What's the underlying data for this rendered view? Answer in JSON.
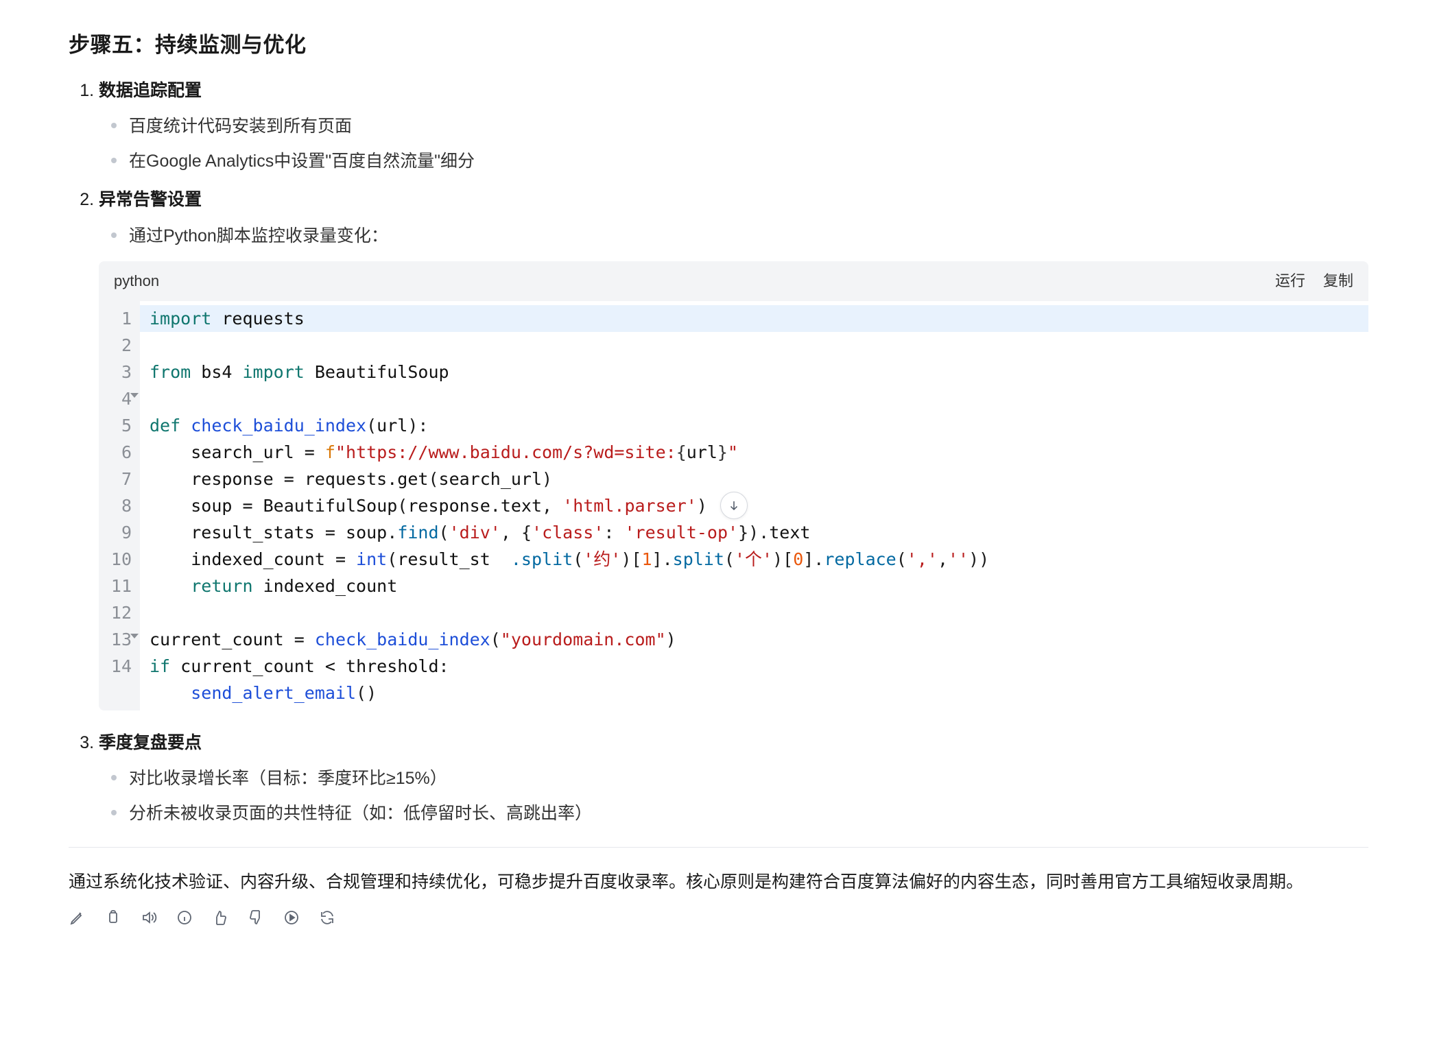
{
  "heading": "步骤五：持续监测与优化",
  "items": {
    "i1": {
      "title": "数据追踪配置",
      "bullets": [
        "百度统计代码安装到所有页面",
        "在Google Analytics中设置\"百度自然流量\"细分"
      ]
    },
    "i2": {
      "title": "异常告警设置",
      "bullets": [
        "通过Python脚本监控收录量变化："
      ]
    },
    "i3": {
      "title": "季度复盘要点",
      "bullets": [
        "对比收录增长率（目标：季度环比≥15%）",
        "分析未被收录页面的共性特征（如：低停留时长、高跳出率）"
      ]
    }
  },
  "code": {
    "lang": "python",
    "actions": {
      "run": "运行",
      "copy": "复制"
    },
    "line_numbers": [
      "1",
      "2",
      "3",
      "4",
      "5",
      "6",
      "7",
      "8",
      "9",
      "10",
      "11",
      "12",
      "13",
      "14"
    ],
    "fold_lines": [
      4,
      13
    ],
    "tokens": {
      "l1": {
        "kw1": "import",
        "mod1": "requests"
      },
      "l2": {
        "kw1": "from",
        "mod1": "bs4",
        "kw2": "import",
        "cls1": "BeautifulSoup"
      },
      "l4": {
        "kw1": "def",
        "fn": "check_baidu_index",
        "p1": "url"
      },
      "l5": {
        "var": "search_url",
        "eq": "=",
        "f": "f",
        "str": "\"https://www.baidu.com/s?wd=site:",
        "interp_open": "{",
        "interp_var": "url",
        "interp_close": "}",
        "str_end": "\""
      },
      "l6": {
        "var": "response",
        "eq": "=",
        "call": "requests.get",
        "arg": "search_url"
      },
      "l7": {
        "var": "soup",
        "eq": "=",
        "call": "BeautifulSoup",
        "arg1": "response.text",
        "arg2": "'html.parser'"
      },
      "l8": {
        "var": "result_stats",
        "eq": "=",
        "obj": "soup",
        "meth": "find",
        "arg1": "'div'",
        "k1": "'class'",
        "v1": "'result-op'",
        "attr": "text"
      },
      "l9": {
        "var": "indexed_count",
        "eq": "=",
        "fn": "int",
        "obj": "result_st",
        "obj2": ".split",
        "s1": "'约'",
        "idx1": "1",
        "m2": "split",
        "s2": "'个'",
        "idx2": "0",
        "m3": "replace",
        "s3a": "','",
        "s3b": "''"
      },
      "l10": {
        "kw": "return",
        "var": "indexed_count"
      },
      "l12": {
        "var": "current_count",
        "eq": "=",
        "fn": "check_baidu_index",
        "arg": "\"yourdomain.com\""
      },
      "l13": {
        "kw": "if",
        "var": "current_count",
        "op": "<",
        "var2": "threshold"
      },
      "l14": {
        "fn": "send_alert_email"
      }
    }
  },
  "summary": "通过系统化技术验证、内容升级、合规管理和持续优化，可稳步提升百度收录率。核心原则是构建符合百度算法偏好的内容生态，同时善用官方工具缩短收录周期。",
  "action_icons": [
    "edit-icon",
    "clipboard-icon",
    "speaker-icon",
    "info-icon",
    "thumbsup-icon",
    "thumbsdown-icon",
    "play-icon",
    "refresh-icon"
  ]
}
